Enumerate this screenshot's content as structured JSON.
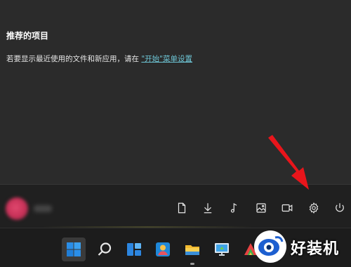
{
  "start_menu": {
    "recommended": {
      "title": "推荐的项目",
      "hint_prefix": "若要显示最近使用的文件和新应用，请在 ",
      "hint_link": "\"开始\"菜单设置"
    },
    "user": {
      "avatar": "user-avatar"
    },
    "quick_access": [
      {
        "icon": "document-icon"
      },
      {
        "icon": "download-icon"
      },
      {
        "icon": "music-icon"
      },
      {
        "icon": "picture-icon"
      },
      {
        "icon": "video-icon"
      },
      {
        "icon": "settings-icon"
      },
      {
        "icon": "power-icon"
      }
    ]
  },
  "annotation": {
    "icon": "red-arrow-icon",
    "color": "#e8151b"
  },
  "taskbar": {
    "items": [
      {
        "icon": "windows-start-icon",
        "active": true
      },
      {
        "icon": "search-icon"
      },
      {
        "icon": "widgets-icon"
      },
      {
        "icon": "people-app-icon"
      },
      {
        "icon": "file-explorer-icon"
      },
      {
        "icon": "remote-desktop-icon"
      },
      {
        "icon": "colorful-app-icon"
      }
    ]
  },
  "watermark": {
    "text": "好装机"
  },
  "colors": {
    "accent": "#0078d4",
    "link": "#6ec6d6",
    "panel": "#2b2b2b",
    "taskbar": "#1c1c1c"
  }
}
